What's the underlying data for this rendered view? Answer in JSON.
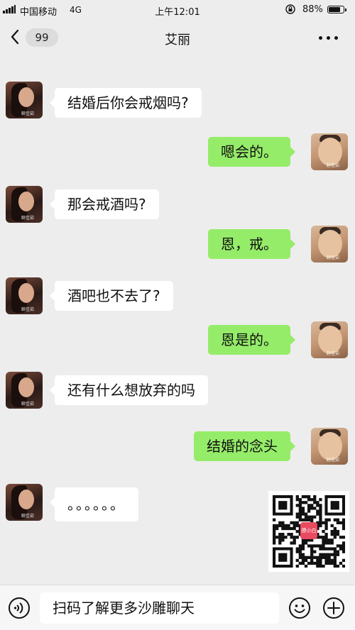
{
  "status_bar": {
    "carrier": "中国移动",
    "network": "4G",
    "time": "上午12:01",
    "battery_percent": "88%",
    "battery_level": 0.88
  },
  "nav": {
    "back_icon": "chevron-left-icon",
    "unread_count": "99",
    "title": "艾丽",
    "more_icon": "ellipsis-icon"
  },
  "colors": {
    "background": "#ededed",
    "sent_bubble": "#95ec69",
    "received_bubble": "#ffffff"
  },
  "messages": [
    {
      "from": "her",
      "text": "结婚后你会戒烟吗?"
    },
    {
      "from": "me",
      "text": "嗯会的。"
    },
    {
      "from": "her",
      "text": "那会戒酒吗?"
    },
    {
      "from": "me",
      "text": "恩，戒。"
    },
    {
      "from": "her",
      "text": "酒吧也不去了?"
    },
    {
      "from": "me",
      "text": "恩是的。"
    },
    {
      "from": "her",
      "text": "还有什么想放弃的吗"
    },
    {
      "from": "me",
      "text": "结婚的念头"
    },
    {
      "from": "her",
      "text": "。。。。。。"
    }
  ],
  "avatar_watermarks": {
    "her": "聊佳茹",
    "him": "赵佳茹"
  },
  "qr_code": {
    "icon": "qr-code-icon",
    "logo_text": "撩小白"
  },
  "input_bar": {
    "voice_icon": "voice-icon",
    "text": "扫码了解更多沙雕聊天",
    "emoji_icon": "emoji-icon",
    "plus_icon": "plus-icon"
  }
}
